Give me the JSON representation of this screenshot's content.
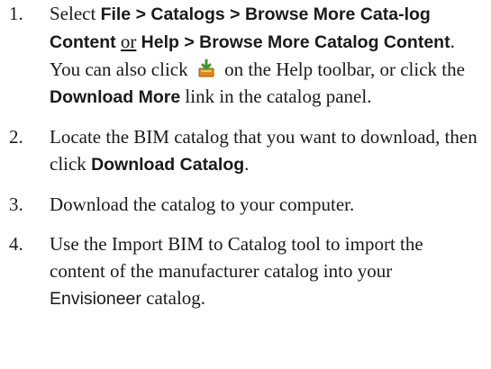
{
  "steps": [
    {
      "number": "1.",
      "text_1": "Select ",
      "menu_path_1": "File > Catalogs > Browse More Cata-log Content",
      "or_text": "or",
      "menu_path_2": "Help > Browse More Catalog Content",
      "text_2": ". You can also click ",
      "icon_name": "download-catalog-icon",
      "text_3": " on the Help toolbar, or click the ",
      "link_label": "Download More",
      "text_4": " link in the catalog panel."
    },
    {
      "number": "2.",
      "text_1": "Locate the BIM catalog that you want to download, then click ",
      "button_label": "Download Catalog",
      "text_2": "."
    },
    {
      "number": "3.",
      "text_1": "Download the catalog to your computer."
    },
    {
      "number": "4.",
      "text_1": "Use the Import BIM to Catalog tool to import the content of the manufacturer catalog into your ",
      "product_name": "Envisioneer",
      "text_2": " catalog."
    }
  ],
  "colors": {
    "text": "#1a1a1a",
    "icon_green": "#3a9a2a",
    "icon_orange": "#e08a1c"
  }
}
